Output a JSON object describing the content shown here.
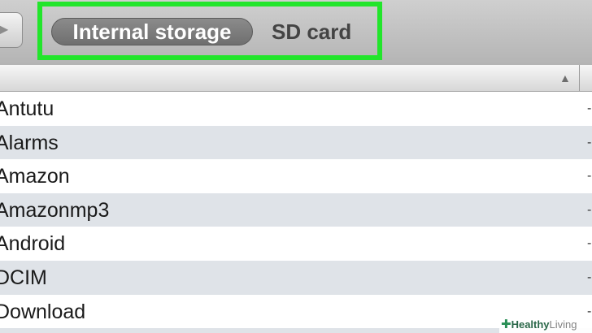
{
  "toolbar": {
    "back_icon": "arrow-right-icon",
    "tabs": [
      {
        "label": "Internal storage",
        "selected": true
      },
      {
        "label": "SD card",
        "selected": false
      }
    ],
    "highlight_color": "#22e52b"
  },
  "list_header": {
    "sort_icon": "triangle-up-icon",
    "sort_glyph": "▲"
  },
  "files": [
    {
      "name": "Antutu",
      "kind": "-"
    },
    {
      "name": "Alarms",
      "kind": "-"
    },
    {
      "name": "Amazon",
      "kind": "-"
    },
    {
      "name": "Amazonmp3",
      "kind": "-"
    },
    {
      "name": "Android",
      "kind": "-"
    },
    {
      "name": "DCIM",
      "kind": "-"
    },
    {
      "name": "Download",
      "kind": "-"
    }
  ],
  "watermark": {
    "part1": "Healthy",
    "part2": "Living"
  }
}
